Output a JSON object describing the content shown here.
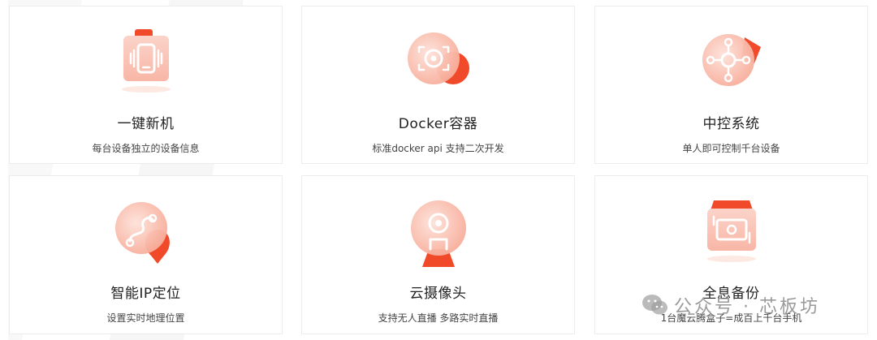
{
  "features": [
    {
      "title": "一键新机",
      "desc": "每台设备独立的设备信息",
      "icon": "phone-device-icon"
    },
    {
      "title": "Docker容器",
      "desc": "标准docker api 支持二次开发",
      "icon": "container-target-icon"
    },
    {
      "title": "中控系统",
      "desc": "单人即可控制千台设备",
      "icon": "central-control-icon"
    },
    {
      "title": "智能IP定位",
      "desc": "设置实时地理位置",
      "icon": "location-route-icon"
    },
    {
      "title": "云摄像头",
      "desc": "支持无人直播 多路实时直播",
      "icon": "webcam-icon"
    },
    {
      "title": "全息备份",
      "desc": "1台魔云腾盒子=成百上千台手机",
      "icon": "backup-photos-icon"
    }
  ],
  "watermark": {
    "text": "公众号 · 芯板坊",
    "icon": "wechat-logo-icon"
  },
  "colors": {
    "accent": "#f04a2a",
    "accent_light": "#fde3dc"
  }
}
